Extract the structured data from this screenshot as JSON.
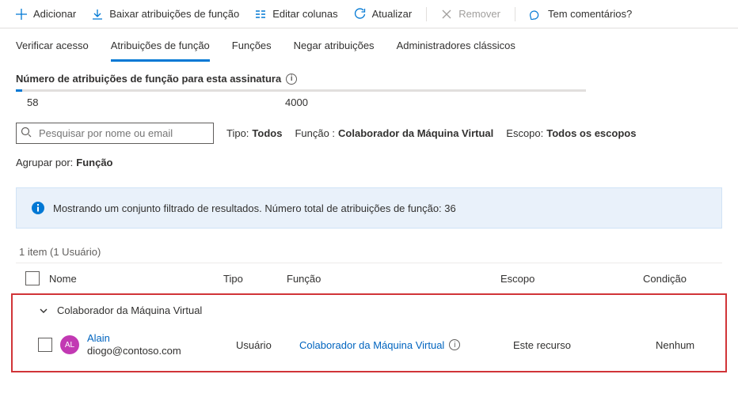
{
  "toolbar": {
    "add": "Adicionar",
    "download": "Baixar atribuições de função",
    "columns": "Editar colunas",
    "refresh": "Atualizar",
    "remove": "Remover",
    "feedback": "Tem comentários?"
  },
  "tabs": {
    "check": "Verificar acesso",
    "assignments": "Atribuições de função",
    "roles": "Funções",
    "deny": "Negar atribuições",
    "classic": "Administradores clássicos"
  },
  "stats": {
    "label": "Número de atribuições de função para esta assinatura",
    "used": "58",
    "total": "4000"
  },
  "search": {
    "placeholder": "Pesquisar por nome ou email"
  },
  "filters": {
    "type_key": "Tipo:",
    "type_val": "Todos",
    "role_key": "Função :",
    "role_val": "Colaborador da Máquina Virtual",
    "scope_key": "Escopo:",
    "scope_val": "Todos os escopos",
    "group_key": "Agrupar por:",
    "group_val": "Função"
  },
  "notice": "Mostrando um conjunto filtrado de resultados. Número total de atribuições de função: 36",
  "count": "1 item (1 Usuário)",
  "columns": {
    "name": "Nome",
    "type": "Tipo",
    "role": "Função",
    "scope": "Escopo",
    "condition": "Condição"
  },
  "group": {
    "title": "Colaborador da Máquina Virtual"
  },
  "row": {
    "avatar": "AL",
    "name": "Alain",
    "email": "diogo@contoso.com",
    "type": "Usuário",
    "role": "Colaborador da Máquina Virtual",
    "scope": "Este recurso",
    "condition": "Nenhum"
  }
}
